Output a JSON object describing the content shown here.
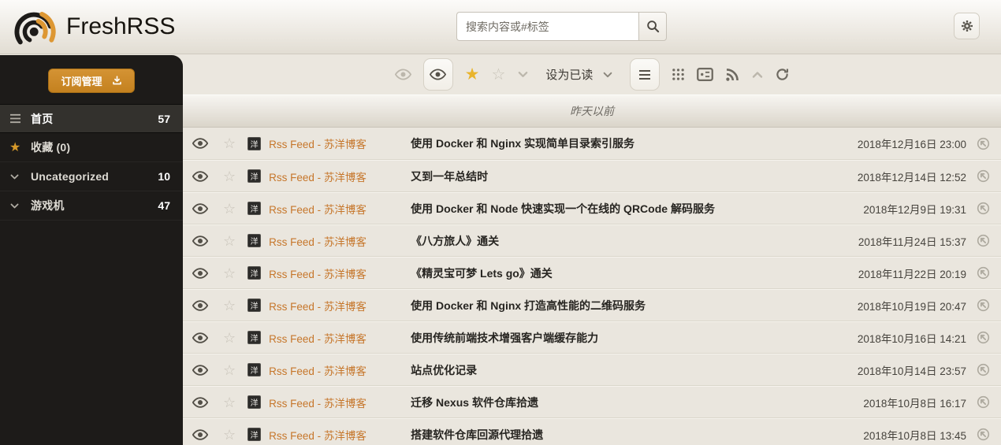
{
  "header": {
    "app_name": "FreshRSS",
    "search_placeholder": "搜索内容或#标签"
  },
  "sidebar": {
    "manage_button_label": "订阅管理",
    "items": [
      {
        "label": "首页",
        "count": "57",
        "icon": "menu",
        "active": true
      },
      {
        "label": "收藏 (0)",
        "count": "",
        "icon": "star",
        "active": false
      },
      {
        "label": "Uncategorized",
        "count": "10",
        "icon": "chevron-down",
        "active": false
      },
      {
        "label": "游戏机",
        "count": "47",
        "icon": "chevron-down",
        "active": false
      }
    ]
  },
  "toolbar": {
    "mark_read_label": "设为已读"
  },
  "list": {
    "day_header": "昨天以前",
    "feed_name": "Rss Feed - 苏洋博客",
    "favicon_text": "洋",
    "articles": [
      {
        "title": "使用 Docker 和 Nginx 实现简单目录索引服务",
        "date": "2018年12月16日 23:00"
      },
      {
        "title": "又到一年总结时",
        "date": "2018年12月14日 12:52"
      },
      {
        "title": "使用 Docker 和 Node 快速实现一个在线的 QRCode 解码服务",
        "date": "2018年12月9日 19:31"
      },
      {
        "title": "《八方旅人》通关",
        "date": "2018年11月24日 15:37"
      },
      {
        "title": "《精灵宝可梦 Lets go》通关",
        "date": "2018年11月22日 20:19"
      },
      {
        "title": "使用 Docker 和 Nginx 打造高性能的二维码服务",
        "date": "2018年10月19日 20:47"
      },
      {
        "title": "使用传统前端技术增强客户端缓存能力",
        "date": "2018年10月16日 14:21"
      },
      {
        "title": "站点优化记录",
        "date": "2018年10月14日 23:57"
      },
      {
        "title": "迁移 Nexus 软件仓库拾遗",
        "date": "2018年10月8日 16:17"
      },
      {
        "title": "搭建软件仓库回源代理拾遗",
        "date": "2018年10月8日 13:45"
      }
    ]
  },
  "colors": {
    "accent_orange": "#cd8b30",
    "star_gold": "#e9b42c",
    "feed_link": "#c6762a",
    "sidebar_bg": "#1d1b19",
    "content_bg": "#ebe7df",
    "title_text": "#272521"
  }
}
